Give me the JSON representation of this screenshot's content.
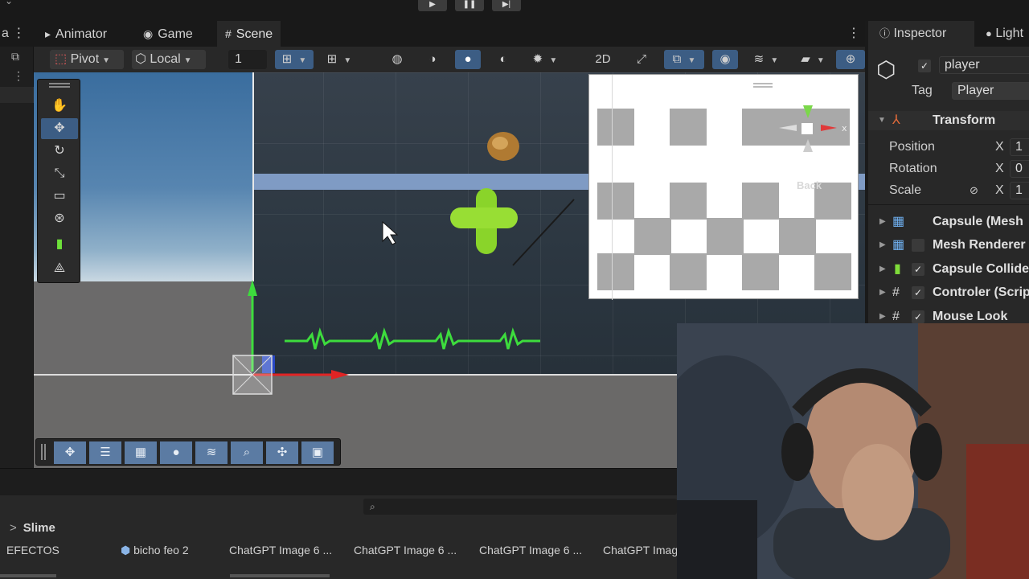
{
  "tabs": [
    {
      "label": "Animator",
      "icon": "animator-icon"
    },
    {
      "label": "Game",
      "icon": "gamepad-icon"
    },
    {
      "label": "Scene",
      "icon": "hash-icon"
    }
  ],
  "toolbar": {
    "pivot_label": "Pivot",
    "local_label": "Local",
    "snap_value": "1"
  },
  "inspector": {
    "tabs": [
      "Inspector",
      "Light"
    ],
    "object_name": "player",
    "tag_label": "Tag",
    "tag_value": "Player",
    "transform": {
      "title": "Transform",
      "position_label": "Position",
      "rotation_label": "Rotation",
      "scale_label": "Scale",
      "axis_x": "X",
      "position_x": "1",
      "rotation_x": "0",
      "scale_x": "1"
    },
    "components": [
      {
        "label": "Capsule (Mesh",
        "icon": "mesh-grid-icon",
        "checkbox": false
      },
      {
        "label": "Mesh Renderer",
        "icon": "mesh-renderer-icon",
        "checkbox": true
      },
      {
        "label": "Capsule Collide",
        "icon": "capsule-collider-icon",
        "checkbox": true
      },
      {
        "label": "Controler (Scrip",
        "icon": "script-icon",
        "checkbox": true
      },
      {
        "label": "Mouse Look",
        "icon": "script-icon",
        "checkbox": true
      }
    ]
  },
  "overlay": {
    "back_label": "Back"
  },
  "project": {
    "breadcrumb_sep": ">",
    "breadcrumb_current": "Slime",
    "assets": [
      "EFECTOS",
      "bicho feo 2",
      "ChatGPT Image 6 ...",
      "ChatGPT Image 6 ...",
      "ChatGPT Image 6 ...",
      "ChatGPT Imag"
    ]
  },
  "colors": {
    "accent_blue": "#3c5d84",
    "gizmo_green": "#3ddc3d",
    "gizmo_red": "#e02424",
    "slime_green": "#8ad42a"
  }
}
